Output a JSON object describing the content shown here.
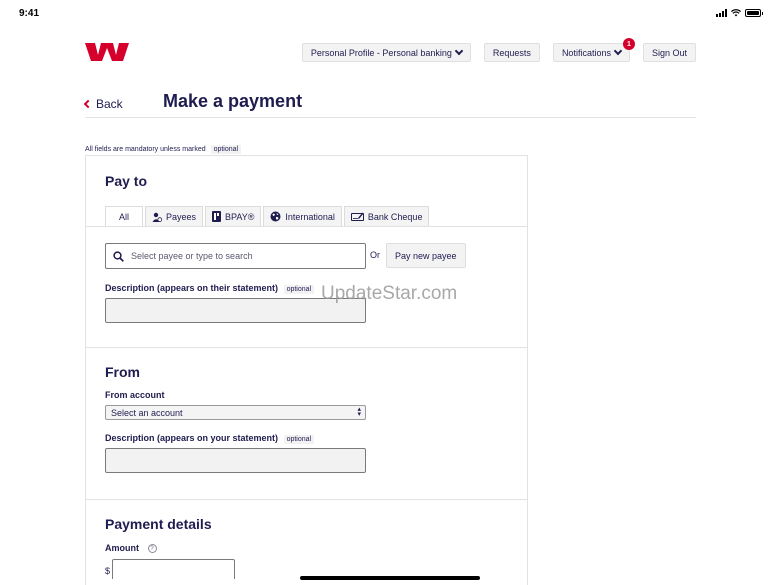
{
  "status_bar": {
    "time": "9:41"
  },
  "brand": {
    "logo_icon": "westpac-logo-icon",
    "color": "#d5002b"
  },
  "top_nav": {
    "profile_label": "Personal Profile - Personal banking",
    "requests_label": "Requests",
    "notifications_label": "Notifications",
    "notifications_count": "1",
    "signout_label": "Sign Out"
  },
  "header": {
    "back_label": "Back",
    "title": "Make a payment"
  },
  "form": {
    "mandatory_note": "All fields are mandatory unless marked",
    "optional_tag": "optional",
    "pay_to": {
      "title": "Pay to",
      "tabs": [
        {
          "label": "All",
          "icon": null
        },
        {
          "label": "Payees",
          "icon": "person-icon"
        },
        {
          "label": "BPAY®",
          "icon": "bpay-icon"
        },
        {
          "label": "International",
          "icon": "globe-icon"
        },
        {
          "label": "Bank Cheque",
          "icon": "cheque-icon"
        }
      ],
      "active_tab": "All",
      "search_placeholder": "Select payee or type to search",
      "or_label": "Or",
      "pay_new_label": "Pay new payee",
      "description_label": "Description (appears on their statement)",
      "description_optional": "optional"
    },
    "from": {
      "title": "From",
      "account_label": "From account",
      "account_selected": "Select an account",
      "description_label": "Description (appears on your statement)",
      "description_optional": "optional"
    },
    "payment_details": {
      "title": "Payment details",
      "amount_label": "Amount",
      "currency_symbol": "$"
    }
  },
  "watermark": "UpdateStar.com"
}
